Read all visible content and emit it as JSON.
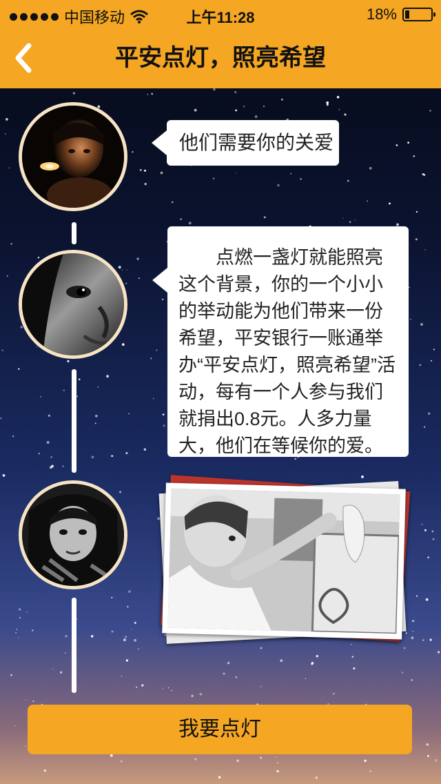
{
  "status_bar": {
    "carrier": "中国移动",
    "time": "上午11:28",
    "battery_level": "18%",
    "battery_fraction": 0.18
  },
  "header": {
    "title": "平安点灯，照亮希望",
    "back_icon": "chevron-left-icon"
  },
  "timeline": {
    "bubble_1": "他们需要你的关爱",
    "bubble_2": "点燃一盏灯就能照亮这个背景，你的一个小小的举动能为他们带来一份希望，平安银行一账通举办“平安点灯，照亮希望”活动，每有一个人参与我们就捐出0.8元。人多力量大，他们在等候你的爱。"
  },
  "cta": {
    "label": "我要点灯"
  },
  "colors": {
    "accent": "#f5a623",
    "avatar_border": "#f7e4c4",
    "bubble_bg": "#ffffff"
  }
}
